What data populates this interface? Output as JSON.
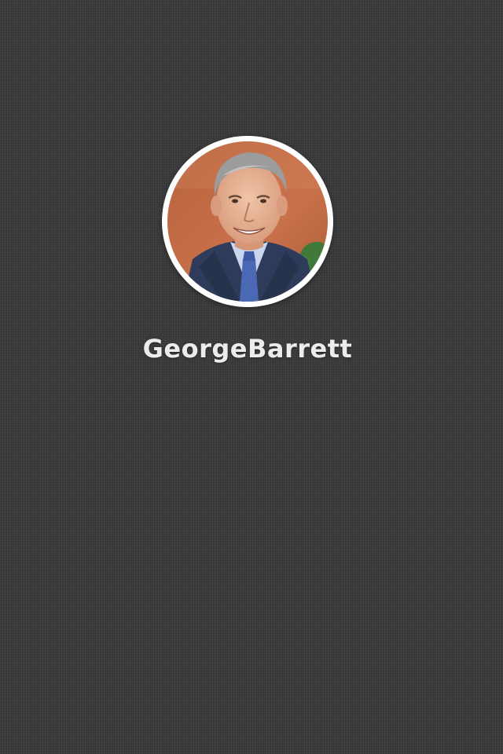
{
  "profile": {
    "name": "GeorgeBarrett",
    "avatar_icon": "avatar-photo"
  },
  "colors": {
    "background": "#3a3b3d",
    "name_text": "#ececec",
    "avatar_ring": "#ffffff"
  }
}
